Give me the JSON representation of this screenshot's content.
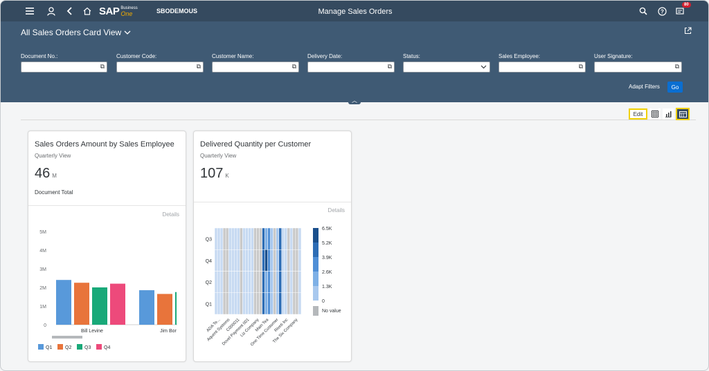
{
  "shell": {
    "menu_icon": "hamburger-icon",
    "user_icon": "user-icon",
    "back_icon": "back-icon",
    "home_icon": "home-icon",
    "logo_text": "SAP",
    "logo_business": "Business",
    "logo_one": "One",
    "company": "SBODEMOUS",
    "title": "Manage Sales Orders",
    "notification_count": "80"
  },
  "header": {
    "variant": "All Sales Orders Card View",
    "filters": [
      {
        "label": "Document No.:",
        "value": ""
      },
      {
        "label": "Customer Code:",
        "value": ""
      },
      {
        "label": "Customer Name:",
        "value": ""
      },
      {
        "label": "Delivery Date:",
        "value": ""
      },
      {
        "label": "Status:",
        "value": ""
      },
      {
        "label": "Sales Employee:",
        "value": ""
      },
      {
        "label": "User Signature:",
        "value": ""
      }
    ],
    "adapt_filters": "Adapt Filters",
    "go": "Go"
  },
  "toolbar": {
    "edit": "Edit"
  },
  "cards": [
    {
      "title": "Sales Orders Amount by Sales Employee",
      "subtitle": "Quarterly View",
      "kpi_value": "46",
      "kpi_unit": "M",
      "kpi_label": "Document Total",
      "details": "Details"
    },
    {
      "title": "Delivered Quantity per Customer",
      "subtitle": "Quarterly View",
      "kpi_value": "107",
      "kpi_unit": "K",
      "details": "Details"
    }
  ],
  "chart_data": [
    {
      "type": "bar",
      "categories": [
        "Bill Levine",
        "Jim Bor"
      ],
      "series": [
        {
          "name": "Q1",
          "values": [
            2.4,
            1.85
          ],
          "color": "#5899da"
        },
        {
          "name": "Q2",
          "values": [
            2.25,
            1.65
          ],
          "color": "#e8743b"
        },
        {
          "name": "Q3",
          "values": [
            2.0,
            1.75
          ],
          "color": "#19a979"
        },
        {
          "name": "Q4",
          "values": [
            2.2,
            null
          ],
          "color": "#ed4a7b"
        }
      ],
      "yticks": [
        "0",
        "1M",
        "2M",
        "3M",
        "4M",
        "5M"
      ],
      "ylim": [
        0,
        5
      ],
      "legend": "bottom"
    },
    {
      "type": "heatmap",
      "rows": [
        "Q3",
        "Q4",
        "Q2",
        "Q1"
      ],
      "columns": [
        "ADA Te...",
        "Aquent Systems",
        "C000011",
        "Dovel Payment 001",
        "Liz Company",
        "Main Tea",
        "One Time Customer",
        "Riveti Inc",
        "The Six Company"
      ],
      "legend_ticks": [
        "6.5K",
        "5.2K",
        "3.9K",
        "2.6K",
        "1.3K",
        "0"
      ],
      "no_value_label": "No value",
      "color_scale": [
        "#c7daf2",
        "#a8c8ee",
        "#7eb0e6",
        "#4f8fd6",
        "#2d6db5",
        "#1a4f8c"
      ]
    }
  ]
}
